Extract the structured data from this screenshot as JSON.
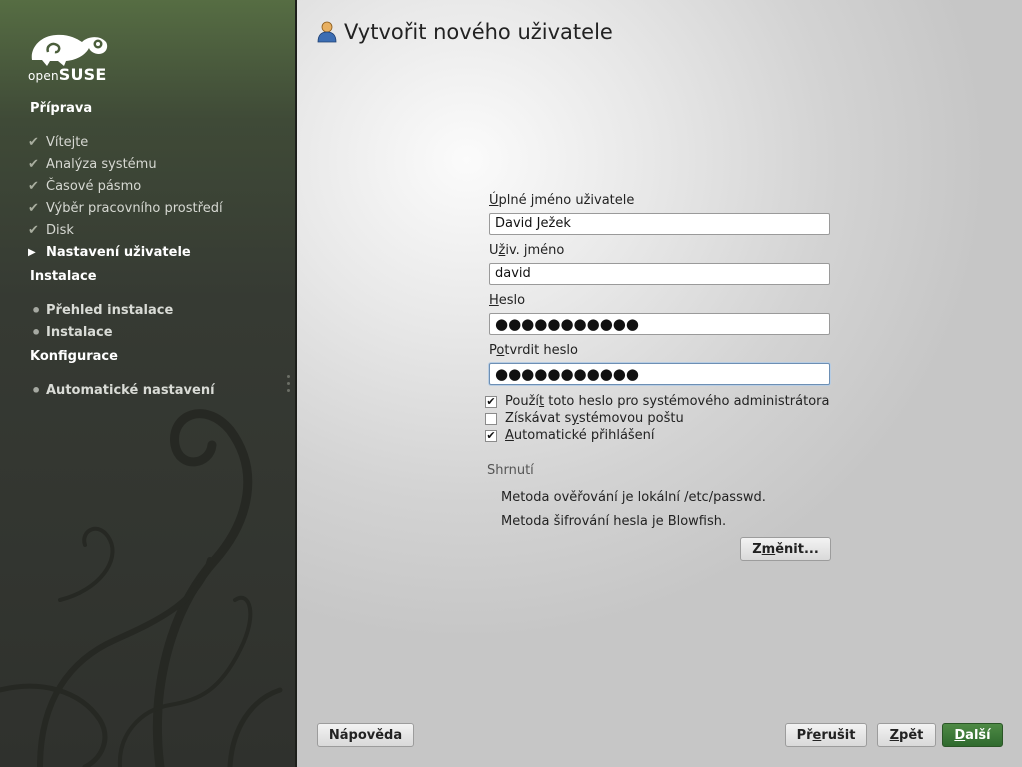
{
  "brand": {
    "logo_small": "open",
    "logo_big": "SUSE"
  },
  "sidebar": {
    "sections": [
      {
        "title": "Příprava"
      },
      {
        "title": "Instalace"
      },
      {
        "title": "Konfigurace"
      }
    ],
    "steps": [
      {
        "label": "Vítejte",
        "state": "done"
      },
      {
        "label": "Analýza systému",
        "state": "done"
      },
      {
        "label": "Časové pásmo",
        "state": "done"
      },
      {
        "label": "Výběr pracovního prostředí",
        "state": "done"
      },
      {
        "label": "Disk",
        "state": "done"
      },
      {
        "label": "Nastavení uživatele",
        "state": "current"
      },
      {
        "label": "Přehled instalace",
        "state": "todo"
      },
      {
        "label": "Instalace",
        "state": "todo"
      },
      {
        "label": "Automatické nastavení",
        "state": "todo"
      }
    ],
    "icons": {
      "done": "check-icon",
      "current": "arrow-right-icon",
      "todo": "bullet-icon"
    }
  },
  "page": {
    "title": "Vytvořit nového uživatele",
    "title_icon": "user-icon"
  },
  "form": {
    "full_name": {
      "label_u": "Ú",
      "label_rest": "plné jméno uživatele",
      "value": "David Ježek"
    },
    "username": {
      "label_pre": "U",
      "label_u": "ž",
      "label_rest": "iv. jméno",
      "value": "david"
    },
    "password": {
      "label_u": "H",
      "label_rest": "eslo",
      "value": "●●●●●●●●●●●"
    },
    "confirm": {
      "label_pre": "P",
      "label_u": "o",
      "label_rest": "tvrdit heslo",
      "value": "●●●●●●●●●●●"
    },
    "checkboxes": [
      {
        "label_pre": "Použí",
        "label_u": "t",
        "label_rest": " toto heslo pro systémového administrátora",
        "checked": true
      },
      {
        "label_pre": "Získávat s",
        "label_u": "y",
        "label_rest": "stémovou poštu",
        "checked": false
      },
      {
        "label_pre": "",
        "label_u": "A",
        "label_rest": "utomatické přihlášení",
        "checked": true
      }
    ]
  },
  "summary": {
    "title": "Shrnutí",
    "lines": [
      "Metoda ověřování je lokální /etc/passwd.",
      "Metoda šifrování hesla je Blowfish."
    ],
    "change_button": {
      "pre": "Z",
      "u": "m",
      "rest": "ěnit..."
    }
  },
  "footer": {
    "help": "Nápověda",
    "abort": {
      "pre": "Př",
      "u": "e",
      "rest": "rušit"
    },
    "back": {
      "pre": "",
      "u": "Z",
      "rest": "pět"
    },
    "next": {
      "pre": "",
      "u": "D",
      "rest": "alší"
    }
  },
  "colors": {
    "sidebar": "#3a4034",
    "accent_green": "#2f6a2e",
    "page_bg": "#d8d8d8"
  }
}
